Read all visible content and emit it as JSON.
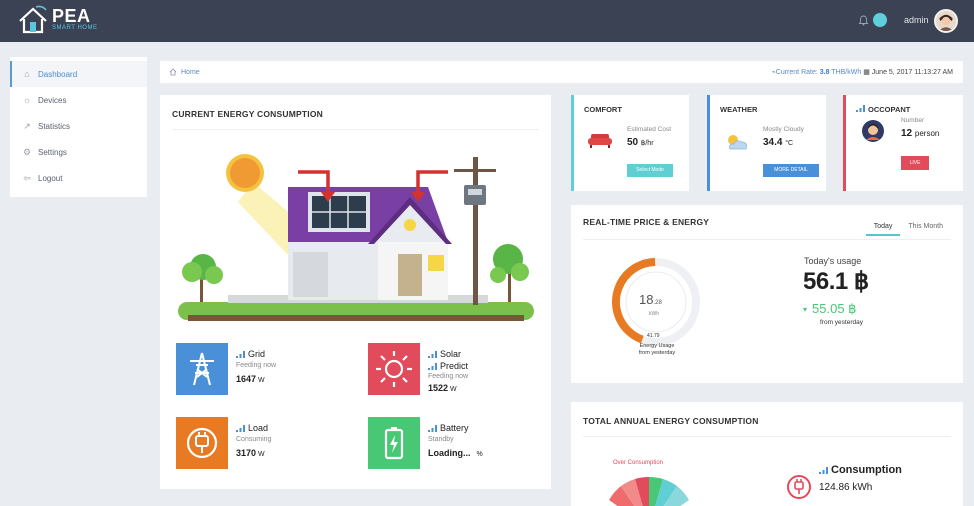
{
  "brand": {
    "title": "PEA",
    "subtitle": "SMART HOME"
  },
  "topbar": {
    "notification_count": "",
    "user": "admin"
  },
  "sidebar": {
    "items": [
      {
        "label": "Dashboard",
        "icon": "home-icon",
        "active": true
      },
      {
        "label": "Devices",
        "icon": "bulb-icon"
      },
      {
        "label": "Statistics",
        "icon": "chart-icon"
      },
      {
        "label": "Settings",
        "icon": "gear-icon"
      },
      {
        "label": "Logout",
        "icon": "logout-icon"
      }
    ]
  },
  "breadcrumb": {
    "home": "Home"
  },
  "rate": {
    "prefix": "Current Rate: ",
    "value": "3.8",
    "unit": " THB/kWh",
    "date": "June 5, 2017 11:13:27 AM"
  },
  "consumption": {
    "title": "CURRENT ENERGY CONSUMPTION",
    "stats": [
      {
        "name": "Grid",
        "sub": "Feeding now",
        "value": "1647",
        "unit": "W",
        "color": "#4a90d9"
      },
      {
        "name": "Solar",
        "name2": "Predict",
        "sub": "Feeding now",
        "value": "1522",
        "unit": "W",
        "color": "#e24b5b"
      },
      {
        "name": "Load",
        "sub": "Consuming",
        "value": "3170",
        "unit": "W",
        "color": "#e87a24"
      },
      {
        "name": "Battery",
        "sub": "Standby",
        "value": "Loading...",
        "unit": "%",
        "color": "#48c774"
      }
    ]
  },
  "comfort": {
    "title": "COMFORT",
    "label": "Estimated Cost",
    "value": "50",
    "unit": "฿/hr",
    "button": "Select Mode",
    "accent": "#5fcfd3"
  },
  "weather": {
    "title": "WEATHER",
    "label": "Mostly Cloudy",
    "value": "34.4",
    "unit": "°C",
    "button": "MORE DETAIL",
    "accent": "#4a90d9"
  },
  "occupant": {
    "title": "OCCOPANT",
    "label": "Number",
    "value": "12",
    "unit": "person",
    "button": "LIVE",
    "accent": "#e24b5b"
  },
  "realtime": {
    "title": "REAL-TIME PRICE & ENERGY",
    "tabs": [
      "Today",
      "This Month"
    ],
    "gauge_value": "18",
    "gauge_decimal": ".28",
    "gauge_unit": "kWh",
    "gauge_max": "41.79",
    "gauge_label1": "Energy Usage",
    "gauge_label2": "from yesterday",
    "gauge_fraction": 0.44,
    "usage_label": "Today's usage",
    "usage_value": "56.1 ฿",
    "diff": "55.05 ฿",
    "diff_label": "from yesterday"
  },
  "annual": {
    "title": "TOTAL ANNUAL ENERGY CONSUMPTION",
    "over_label": "Over Consumption",
    "consumption_label": "Consumption",
    "consumption_value": "124.86 kWh"
  }
}
